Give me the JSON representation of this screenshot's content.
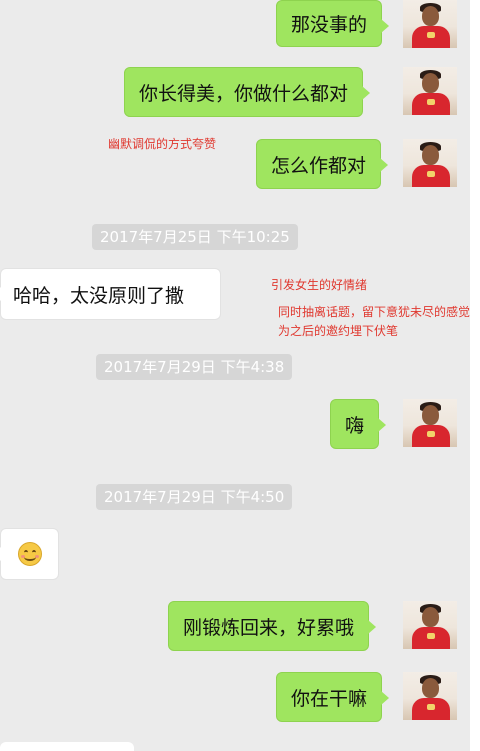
{
  "messages": [
    {
      "side": "out",
      "text": "那没事的"
    },
    {
      "side": "out",
      "text": "你长得美，你做什么都对"
    },
    {
      "side": "out",
      "text": "怎么作都对"
    },
    {
      "side": "in",
      "text": "哈哈，太没原则了撒"
    },
    {
      "side": "out",
      "text": "嗨"
    },
    {
      "side": "in",
      "type": "emoji",
      "emoji": "smile-emoji"
    },
    {
      "side": "out",
      "text": "刚锻炼回来，好累哦"
    },
    {
      "side": "out",
      "text": "你在干嘛"
    }
  ],
  "timestamps": [
    "2017年7月25日 下午10:25",
    "2017年7月29日 下午4:38",
    "2017年7月29日 下午4:50"
  ],
  "annotations": [
    "幽默调侃的方式夸赞",
    "引发女生的好情绪",
    "同时抽离话题，留下意犹未尽的感觉。",
    "为之后的邀约埋下伏笔"
  ],
  "colors": {
    "chat_background": "#ebebeb",
    "outgoing_bubble": "#9fe55f",
    "incoming_bubble": "#ffffff",
    "timestamp_background": "#d6d6d6",
    "annotation": "#e0382f"
  }
}
